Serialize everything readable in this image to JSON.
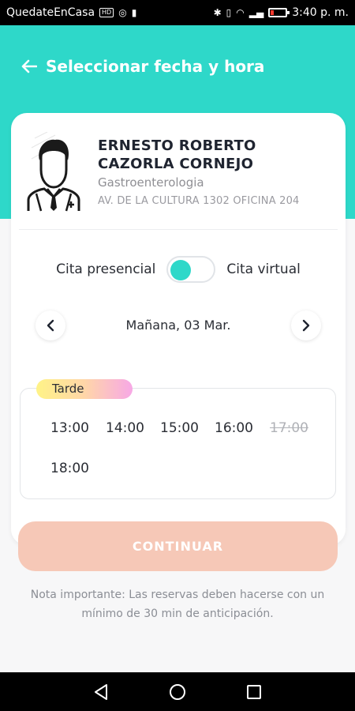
{
  "status_bar": {
    "carrier": "QuedateEnCasa",
    "badge": "HD",
    "time": "3:40 p. m."
  },
  "header": {
    "title": "Seleccionar fecha y hora"
  },
  "doctor": {
    "name": "ERNESTO ROBERTO CAZORLA CORNEJO",
    "specialty": "Gastroenterologia",
    "address": "AV. DE LA CULTURA 1302 OFICINA 204"
  },
  "appointment_type": {
    "option_left": "Cita presencial",
    "option_right": "Cita virtual",
    "selected": "Cita presencial"
  },
  "date_picker": {
    "label": "Mañana, 03 Mar."
  },
  "period": {
    "label": "Tarde",
    "slots": [
      {
        "time": "13:00",
        "available": true
      },
      {
        "time": "14:00",
        "available": true
      },
      {
        "time": "15:00",
        "available": true
      },
      {
        "time": "16:00",
        "available": true
      },
      {
        "time": "17:00",
        "available": false
      },
      {
        "time": "18:00",
        "available": true
      }
    ]
  },
  "actions": {
    "continue_label": "CONTINUAR"
  },
  "note": {
    "text": "Nota importante: Las reservas deben hacerse con un mínimo de 30 min de anticipación."
  },
  "colors": {
    "accent": "#2ed8c9",
    "button_disabled": "#f6c8b7",
    "text_dark": "#1f2430",
    "text_muted": "#8f8f94"
  }
}
